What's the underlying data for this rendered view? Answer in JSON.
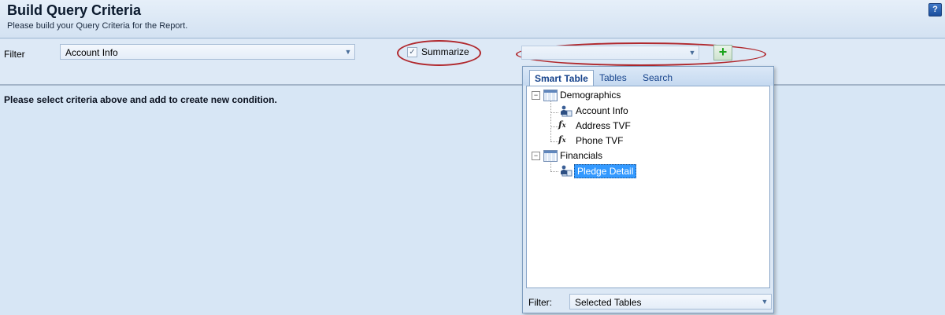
{
  "header": {
    "title": "Build Query Criteria",
    "subtitle": "Please build your Query Criteria for the Report.",
    "help_icon": "?"
  },
  "filter_bar": {
    "label": "Filter",
    "filter_value": "Account Info",
    "summarize_label": "Summarize",
    "summarize_checked": true,
    "field_value": "",
    "add_button": "+"
  },
  "message": "Please select criteria above and add to create new condition.",
  "popup": {
    "tabs": [
      {
        "label": "Smart Table",
        "active": true
      },
      {
        "label": "Tables",
        "active": false
      },
      {
        "label": "Search",
        "active": false
      }
    ],
    "tree": [
      {
        "label": "Demographics",
        "type": "group",
        "expanded": true
      },
      {
        "label": "Account Info",
        "type": "smart-table"
      },
      {
        "label": "Address TVF",
        "type": "function"
      },
      {
        "label": "Phone TVF",
        "type": "function"
      },
      {
        "label": "Financials",
        "type": "group",
        "expanded": true
      },
      {
        "label": "Pledge Detail",
        "type": "smart-table",
        "selected": true
      }
    ],
    "footer": {
      "label": "Filter:",
      "value": "Selected Tables"
    }
  },
  "colors": {
    "annotation_ellipse": "#b0282d",
    "selection": "#3399ff",
    "background": "#d7e6f5"
  }
}
